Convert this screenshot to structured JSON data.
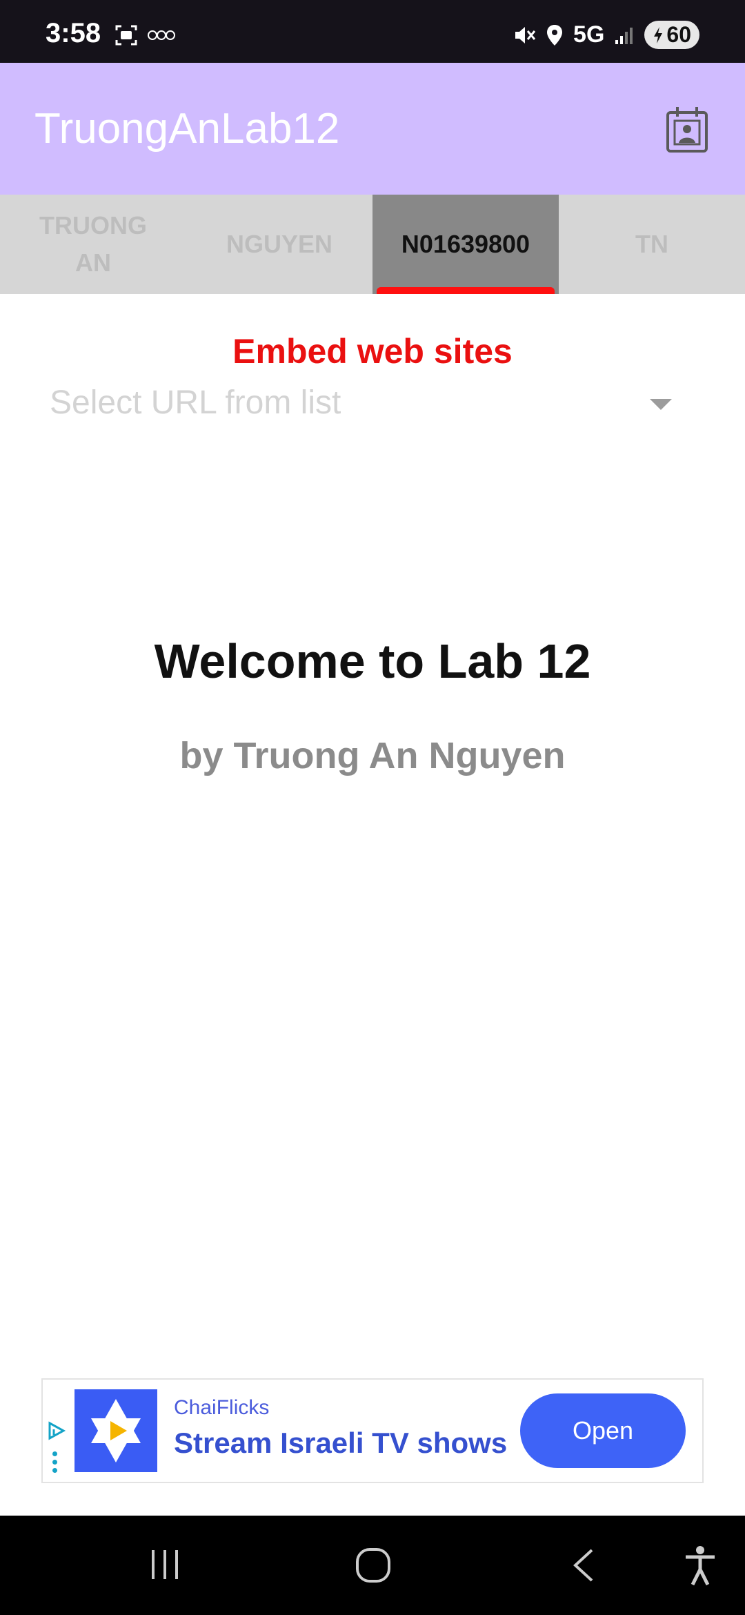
{
  "status_bar": {
    "time": "3:58",
    "network": "5G",
    "battery": "60"
  },
  "app_bar": {
    "title": "TruongAnLab12",
    "action_icon": "contact-calendar-icon"
  },
  "tabs": [
    {
      "label": "TRUONG\nAN",
      "active": false
    },
    {
      "label": "NGUYEN",
      "active": false
    },
    {
      "label": "N01639800",
      "active": true
    },
    {
      "label": "TN",
      "active": false
    }
  ],
  "content": {
    "embed_title": "Embed web sites",
    "url_placeholder": "Select URL from list",
    "welcome": "Welcome to Lab 12",
    "byline": "by Truong An Nguyen"
  },
  "ad": {
    "brand": "ChaiFlicks",
    "headline": "Stream Israeli TV shows",
    "button": "Open"
  },
  "colors": {
    "app_bar": "#d0bcff",
    "embed_title": "#ea1010",
    "tab_indicator": "#ff1010",
    "ad_button": "#3e63f7"
  }
}
